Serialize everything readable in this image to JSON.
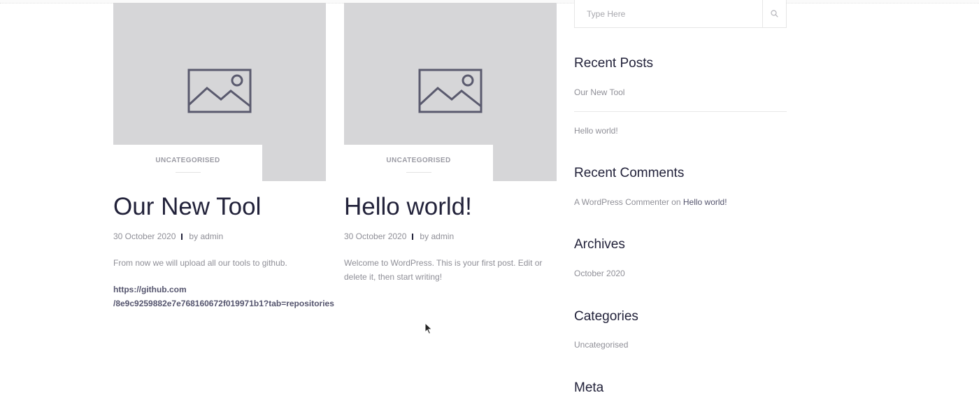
{
  "posts": [
    {
      "category": "UNCATEGORISED",
      "title": "Our New Tool",
      "date": "30 October 2020",
      "by": "by",
      "author": "admin",
      "excerpt": "From now we will upload all our tools to github.",
      "link": "https://github.com/8e9c9259882e7e768160672f019971b1?tab=repositories",
      "link_line1": "https://github.com",
      "link_line2": "/8e9c9259882e7e768160672f019971b1?tab=repositories"
    },
    {
      "category": "UNCATEGORISED",
      "title": "Hello world!",
      "date": "30 October 2020",
      "by": "by",
      "author": "admin",
      "excerpt": "Welcome to WordPress. This is your first post. Edit or delete it, then start writing!"
    }
  ],
  "sidebar": {
    "search": {
      "placeholder": "Type Here",
      "icon": "search-icon"
    },
    "recent_posts": {
      "title": "Recent Posts",
      "items": [
        "Our New Tool",
        "Hello world!"
      ]
    },
    "recent_comments": {
      "title": "Recent Comments",
      "commenter": "A WordPress Commenter",
      "on": "on",
      "post": "Hello world!"
    },
    "archives": {
      "title": "Archives",
      "items": [
        "October 2020"
      ]
    },
    "categories": {
      "title": "Categories",
      "items": [
        "Uncategorised"
      ]
    },
    "meta": {
      "title": "Meta"
    }
  },
  "colors": {
    "background": "#ffffff",
    "thumbnail": "#d6d6d8",
    "heading": "#22223a",
    "muted_text": "#8f8f97",
    "link_text": "#55556e"
  }
}
